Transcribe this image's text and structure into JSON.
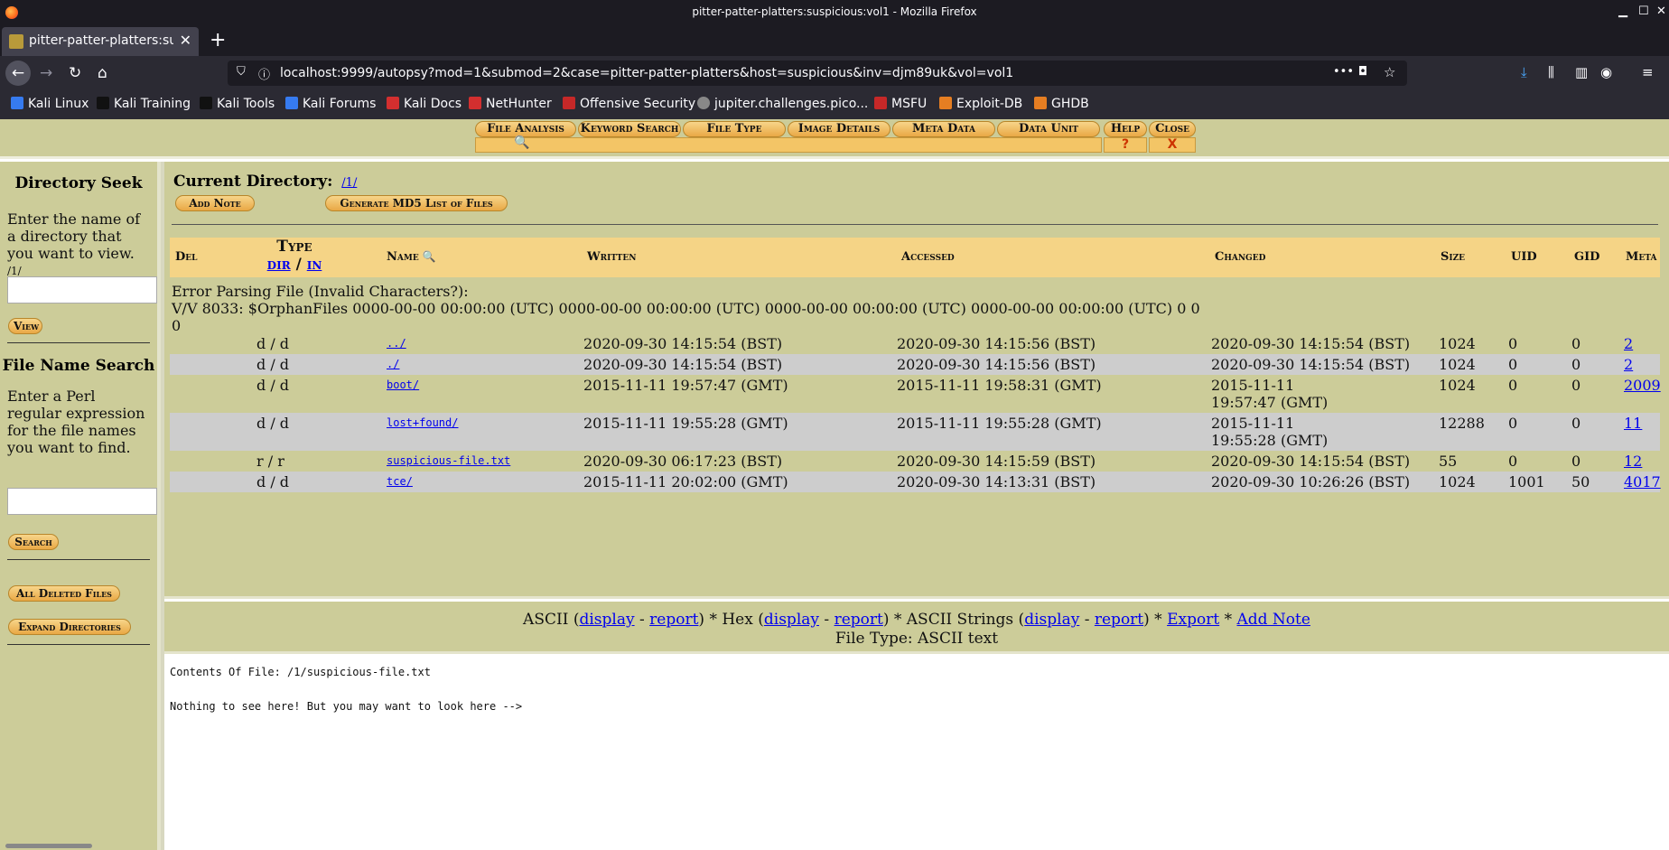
{
  "window": {
    "title": "pitter-patter-platters:suspicious:vol1 - Mozilla Firefox",
    "controls": [
      "▁",
      "☐",
      "✕"
    ]
  },
  "tab": {
    "label": "pitter-patter-platters:sus",
    "close": "✕",
    "new_tab": "+"
  },
  "nav": {
    "back": "←",
    "forward": "→",
    "reload": "↻",
    "home": "⌂",
    "url": "localhost:9999/autopsy?mod=1&submod=2&case=pitter-patter-platters&host=suspicious&inv=djm89uk&vol=vol1",
    "page_actions": "•••"
  },
  "bookmarks": [
    {
      "label": "Kali Linux",
      "color": "#367bf0"
    },
    {
      "label": "Kali Training",
      "color": "#222222"
    },
    {
      "label": "Kali Tools",
      "color": "#222222"
    },
    {
      "label": "Kali Forums",
      "color": "#367bf0"
    },
    {
      "label": "Kali Docs",
      "color": "#d32f2f"
    },
    {
      "label": "NetHunter",
      "color": "#d32f2f"
    },
    {
      "label": "Offensive Security",
      "color": "#c62828"
    },
    {
      "label": "jupiter.challenges.pico...",
      "color": "#888888"
    },
    {
      "label": "MSFU",
      "color": "#c62828"
    },
    {
      "label": "Exploit-DB",
      "color": "#e67e22"
    },
    {
      "label": "GHDB",
      "color": "#e67e22"
    }
  ],
  "menu_tabs": [
    "File Analysis",
    "Keyword Search",
    "File Type",
    "Image Details",
    "Meta Data",
    "Data Unit",
    "Help",
    "Close"
  ],
  "menu_sub": {
    "help": "?",
    "close": "X"
  },
  "left": {
    "dir_seek_title": "Directory Seek",
    "dir_seek_text": "Enter the name of a directory that you want to view.",
    "dir_seek_current": "/1/",
    "view_button": "View",
    "file_search_title": "File Name Search",
    "file_search_text": "Enter a Perl regular expression for the file names you want to find.",
    "search_button": "Search",
    "all_deleted_button": "All Deleted Files",
    "expand_dirs_button": "Expand Directories"
  },
  "main": {
    "current_dir_label": "Current Directory:",
    "current_dir_link": "/1/",
    "add_note_button": "Add Note",
    "md5_button": "Generate MD5 List of Files",
    "headers": {
      "del": "Del",
      "type": "Type",
      "type_dir": "dir",
      "type_sep": "/",
      "type_in": "in",
      "name": "Name",
      "written": "Written",
      "accessed": "Accessed",
      "changed": "Changed",
      "size": "Size",
      "uid": "UID",
      "gid": "GID",
      "meta": "Meta"
    },
    "error_text": "Error Parsing File (Invalid Characters?):\nV/V 8033: $OrphanFiles 0000-00-00 00:00:00 (UTC) 0000-00-00 00:00:00 (UTC) 0000-00-00 00:00:00 (UTC) 0000-00-00 00:00:00 (UTC) 0 0 0",
    "rows": [
      {
        "type": "d / d",
        "name": "../",
        "written": "2020-09-30 14:15:54  (BST)",
        "accessed": "2020-09-30 14:15:56  (BST)",
        "changed": "2020-09-30 14:15:54  (BST)",
        "changed2": "",
        "size": "1024",
        "uid": "0",
        "gid": "0",
        "meta": "2"
      },
      {
        "type": "d / d",
        "name": "./",
        "written": "2020-09-30 14:15:54  (BST)",
        "accessed": "2020-09-30 14:15:56  (BST)",
        "changed": "2020-09-30 14:15:54  (BST)",
        "changed2": "",
        "size": "1024",
        "uid": "0",
        "gid": "0",
        "meta": "2"
      },
      {
        "type": "d / d",
        "name": "boot/",
        "written": "2015-11-11 19:57:47  (GMT)",
        "accessed": "2015-11-11 19:58:31  (GMT)",
        "changed": "2015-11-11",
        "changed2": "19:57:47  (GMT)",
        "size": "1024",
        "uid": "0",
        "gid": "0",
        "meta": "2009"
      },
      {
        "type": "d / d",
        "name": "lost+found/",
        "written": "2015-11-11 19:55:28  (GMT)",
        "accessed": "2015-11-11 19:55:28  (GMT)",
        "changed": "2015-11-11",
        "changed2": "19:55:28  (GMT)",
        "size": "12288",
        "uid": "0",
        "gid": "0",
        "meta": "11"
      },
      {
        "type": "r / r",
        "name": "suspicious-file.txt",
        "written": "2020-09-30 06:17:23  (BST)",
        "accessed": "2020-09-30 14:15:59  (BST)",
        "changed": "2020-09-30 14:15:54  (BST)",
        "changed2": "",
        "size": "55",
        "uid": "0",
        "gid": "0",
        "meta": "12"
      },
      {
        "type": "d / d",
        "name": "tce/",
        "written": "2015-11-11 20:02:00  (GMT)",
        "accessed": "2020-09-30 14:13:31  (BST)",
        "changed": "2020-09-30 10:26:26  (BST)",
        "changed2": "",
        "size": "1024",
        "uid": "1001",
        "gid": "50",
        "meta": "4017"
      }
    ]
  },
  "info": {
    "ascii": "ASCII",
    "hex": "Hex",
    "ascii_strings": "ASCII Strings",
    "display": "display",
    "report": "report",
    "export": "Export",
    "add_note": "Add Note",
    "file_type": "File Type: ASCII text"
  },
  "content": {
    "header": "Contents Of File: /1/suspicious-file.txt",
    "body": "Nothing to see here! But you may want to look here -->"
  }
}
